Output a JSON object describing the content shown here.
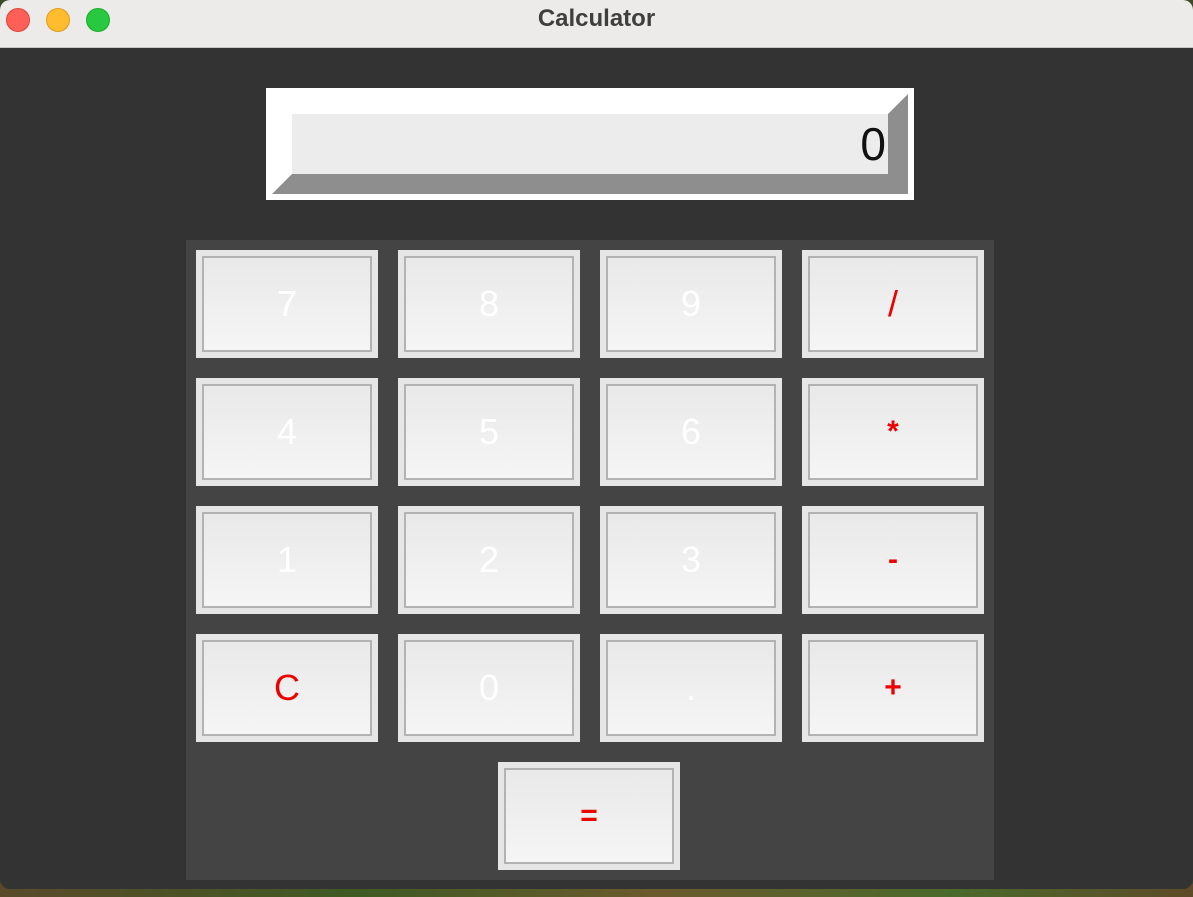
{
  "window": {
    "title": "Calculator"
  },
  "display": {
    "value": "0"
  },
  "keys": {
    "k7": "7",
    "k8": "8",
    "k9": "9",
    "divide": "/",
    "k4": "4",
    "k5": "5",
    "k6": "6",
    "multiply": "*",
    "k1": "1",
    "k2": "2",
    "k3": "3",
    "subtract": "-",
    "clear": "C",
    "k0": "0",
    "decimal": ".",
    "add": "+",
    "equals": "="
  },
  "colors": {
    "window_background": "#333333",
    "keypad_background": "#444444",
    "operator_text": "#ee0000",
    "digit_text": "#ffffff",
    "display_text": "#111111"
  }
}
